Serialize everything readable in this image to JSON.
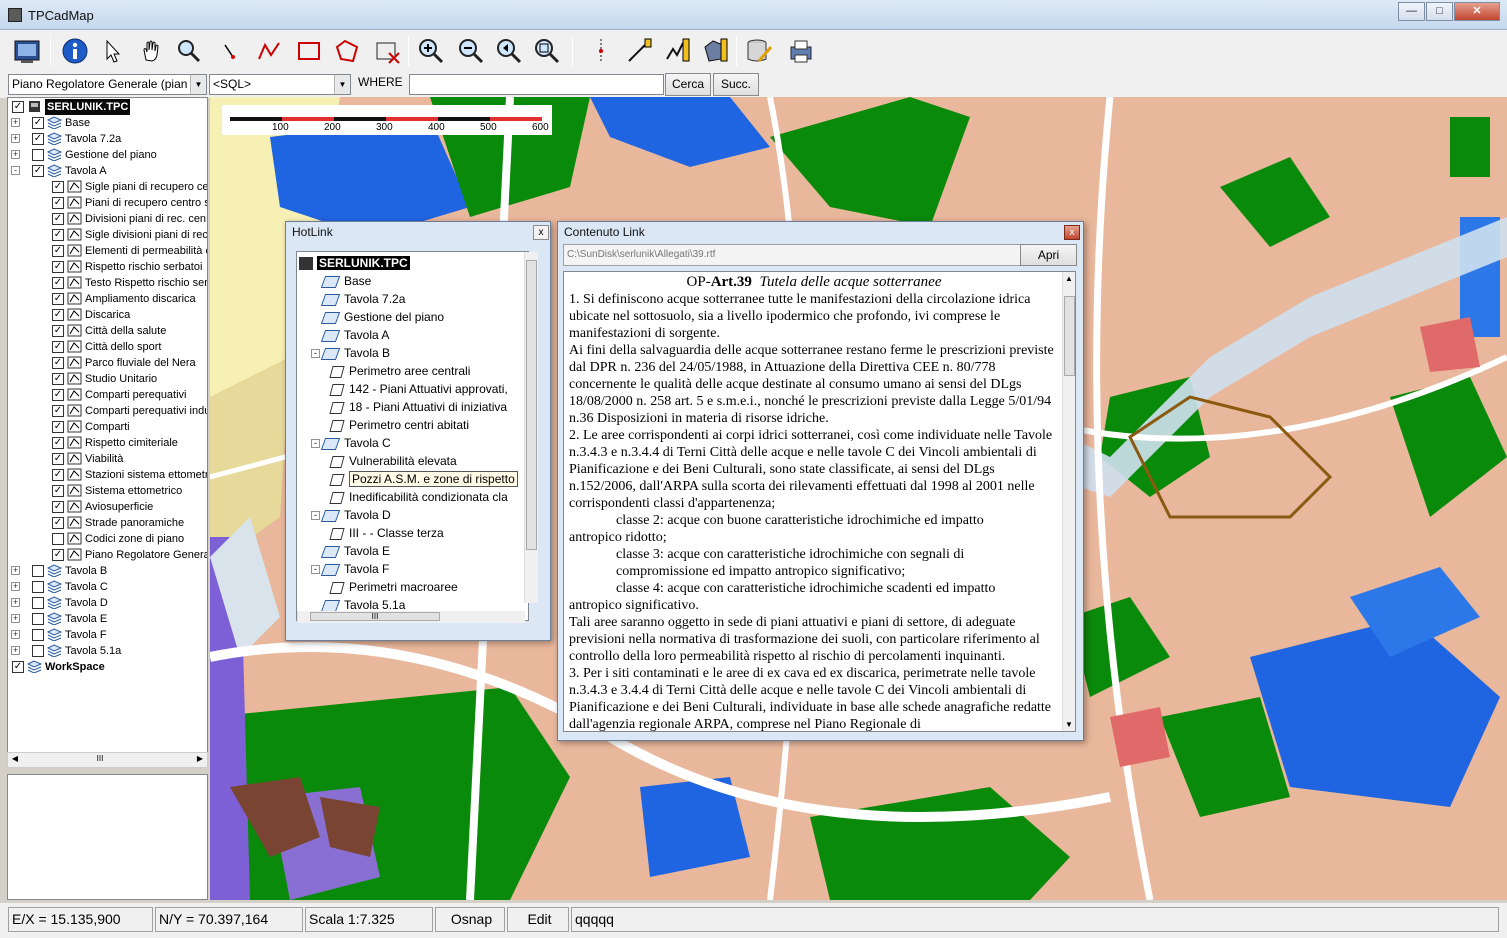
{
  "window": {
    "title": "TPCadMap",
    "min": "0",
    "max": "0",
    "close": "X"
  },
  "querybar": {
    "layer_combo": "Piano Regolatore Generale (pian",
    "sql_combo": "<SQL>",
    "where_label": "WHERE",
    "where_value": "",
    "cerca": "Cerca",
    "succ": "Succ."
  },
  "tree": {
    "root": "SERLUNIK.TPC",
    "nodes": [
      "Base",
      "Tavola 7.2a",
      "Gestione del piano",
      "Tavola A"
    ],
    "tavola_a_children": [
      "Sigle piani di recupero ce",
      "Piani di recupero centro s",
      "Divisioni piani di rec. cen.",
      "Sigle divisioni piani di rec.",
      "Elementi di permeabilità ce",
      "Rispetto rischio serbatoi",
      "Testo Rispetto rischio ser",
      "Ampliamento discarica",
      "Discarica",
      "Città della salute",
      "Città dello sport",
      "Parco fluviale del Nera",
      "Studio Unitario",
      "Comparti perequativi",
      "Comparti perequativi indu",
      "Comparti",
      "Rispetto cimiteriale",
      "Viabilità",
      "Stazioni sistema ettometri",
      "Sistema ettometrico",
      "Aviosuperficie",
      "Strade panoramiche",
      "Codici zone di piano",
      "Piano Regolatore General"
    ],
    "after_nodes": [
      "Tavola B",
      "Tavola C",
      "Tavola D",
      "Tavola E",
      "Tavola F",
      "Tavola 5.1a"
    ],
    "workspace": "WorkSpace"
  },
  "scalebar": {
    "ticks": [
      "100",
      "200",
      "300",
      "400",
      "500",
      "600"
    ]
  },
  "hotlink": {
    "title": "HotLink",
    "close": "x",
    "root": "SERLUNIK.TPC",
    "items": [
      "Base",
      "Tavola 7.2a",
      "Gestione del piano",
      "Tavola A",
      "Tavola B",
      "Perimetro aree centrali",
      "142 - Piani Attuativi approvati,",
      "18 - Piani Attuativi di iniziativa",
      "Perimetro centri abitati",
      "Tavola C",
      "Vulnerabilità elevata",
      "Pozzi A.S.M. e zone di rispetto",
      "Inedificabilità condizionata cla",
      "Tavola D",
      "III - - Classe terza",
      "Tavola E",
      "Tavola F",
      "Perimetri macroaree",
      "Tavola 5.1a"
    ],
    "hscroll": "III"
  },
  "contenuto": {
    "title": "Contenuto Link",
    "close": "x",
    "path": "C:\\SunDisk\\serlunik\\Allegati\\39.rtf",
    "apri": "Apri",
    "heading_prefix": "OP-",
    "heading_art": "Art.39",
    "heading_title": "Tutela delle acque sotterranee",
    "p1": "1. Si definiscono acque sotterranee tutte le manifestazioni della circolazione idrica ubicate nel sottosuolo, sia a livello ipodermico che profondo, ivi comprese le manifestazioni di sorgente.",
    "p2": "Ai fini della salvaguardia delle acque sotterranee  restano ferme le prescrizioni previste dal DPR n. 236 del 24/05/1988, in Attuazione della Direttiva CEE n. 80/778 concernente le qualità delle acque destinate al consumo umano ai sensi del DLgs 18/08/2000  n. 258  art. 5 e s.m.e.i.,  nonché  le prescrizioni previste dalla Legge 5/01/94  n.36  Disposizioni in materia di risorse idriche.",
    "p3": "2. Le aree corrispondenti ai corpi idrici sotterranei, così come individuate nelle Tavole n.3.4.3 e n.3.4.4 di Terni Città delle acque e nelle tavole C dei Vincoli ambientali di Pianificazione e dei Beni Culturali,  sono state classificate, ai sensi del DLgs n.152/2006, dall'ARPA  sulla scorta dei rilevamenti effettuati dal 1998 al 2001  nelle corrispondenti classi d'appartenenza;",
    "c2": "classe 2: acque con buone caratteristiche idrochimiche ed impatto",
    "c2b": "antropico ridotto;",
    "c3": "classe 3: acque con caratteristiche idrochimiche con segnali di compromissione ed impatto antropico significativo;",
    "c4": "classe 4: acque con caratteristiche idrochimiche scadenti ed impatto",
    "c4b": "antropico significativo.",
    "p4": "Tali aree saranno oggetto in sede di piani attuativi e piani di settore, di adeguate previsioni nella normativa di trasformazione dei suoli, con particolare riferimento al controllo della loro permeabilità rispetto al rischio di percolamenti inquinanti.",
    "p5": "3. Per i siti contaminati  e le aree di ex cava ed ex discarica, perimetrate nelle tavole n.3.4.3 e 3.4.4 di Terni Città delle acque  e nelle tavole C dei Vincoli ambientali di Pianificazione e dei Beni Culturali, individuate in base alle schede anagrafiche redatte dall'agenzia regionale ARPA, comprese nel Piano Regionale di"
  },
  "status": {
    "ex": "E/X = 15.135,900",
    "ny": "N/Y = 70.397,164",
    "scala": "Scala 1:7.325",
    "osnap": "Osnap",
    "edit": "Edit",
    "cmd": "qqqqq"
  },
  "colors": {
    "map_building": "#e9b79b",
    "map_green": "#0a8a0a",
    "map_blue": "#1f64e0",
    "map_yellow": "#f7f0b4"
  }
}
